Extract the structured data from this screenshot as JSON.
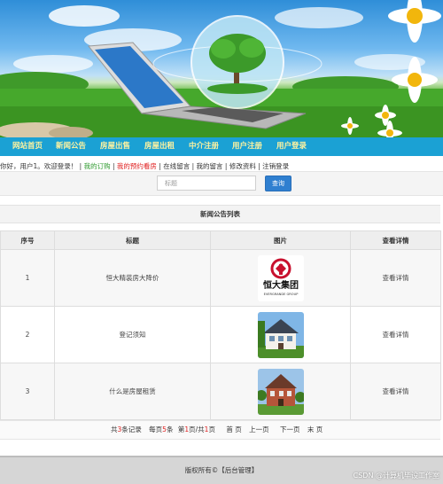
{
  "nav": {
    "items": [
      "网站首页",
      "新闻公告",
      "房屋出售",
      "房屋出租",
      "中介注册",
      "用户注册",
      "用户登录"
    ]
  },
  "userbar": {
    "greeting": "你好，用户1。欢迎登录！",
    "sep": "|",
    "links": [
      "我的订购",
      "我的预约看房",
      "在线留言",
      "我的留言",
      "修改资料",
      "注销登录"
    ]
  },
  "search": {
    "placeholder": "标题",
    "button_label": "查询"
  },
  "list": {
    "title": "新闻公告列表",
    "headers": [
      "序号",
      "标题",
      "图片",
      "查看详情"
    ],
    "rows": [
      {
        "index": "1",
        "title": "恒大精装房大降价",
        "image_icon": "evergrande-logo",
        "logo_text": "恒大集团",
        "logo_sub": "EVERGRANDE GROUP",
        "detail": "查看详情"
      },
      {
        "index": "2",
        "title": "登记须知",
        "image_icon": "house-photo",
        "detail": "查看详情"
      },
      {
        "index": "3",
        "title": "什么是房屋租赁",
        "image_icon": "house-photo",
        "detail": "查看详情"
      }
    ]
  },
  "pager": {
    "total_prefix": "共",
    "total_count": "3",
    "total_suffix": "条记录",
    "per_prefix": "每页",
    "per_count": "5",
    "per_suffix": "条",
    "page_prefix": "第",
    "page_current": "1",
    "page_mid": "页/共",
    "page_total": "1",
    "page_suffix": "页",
    "first": "首 页",
    "prev": "上一页",
    "next": "下一页",
    "last": "末 页"
  },
  "footer": {
    "text": "版权所有©【后台管理】"
  },
  "watermark": "CSDN @计算机毕设工作室",
  "colors": {
    "nav_bg": "#1ba1d4",
    "nav_text": "#fff3a0",
    "link_green": "#2e9a2e",
    "link_red": "#e02020",
    "button_blue": "#2f7fd0",
    "logo_red": "#c8102e"
  }
}
